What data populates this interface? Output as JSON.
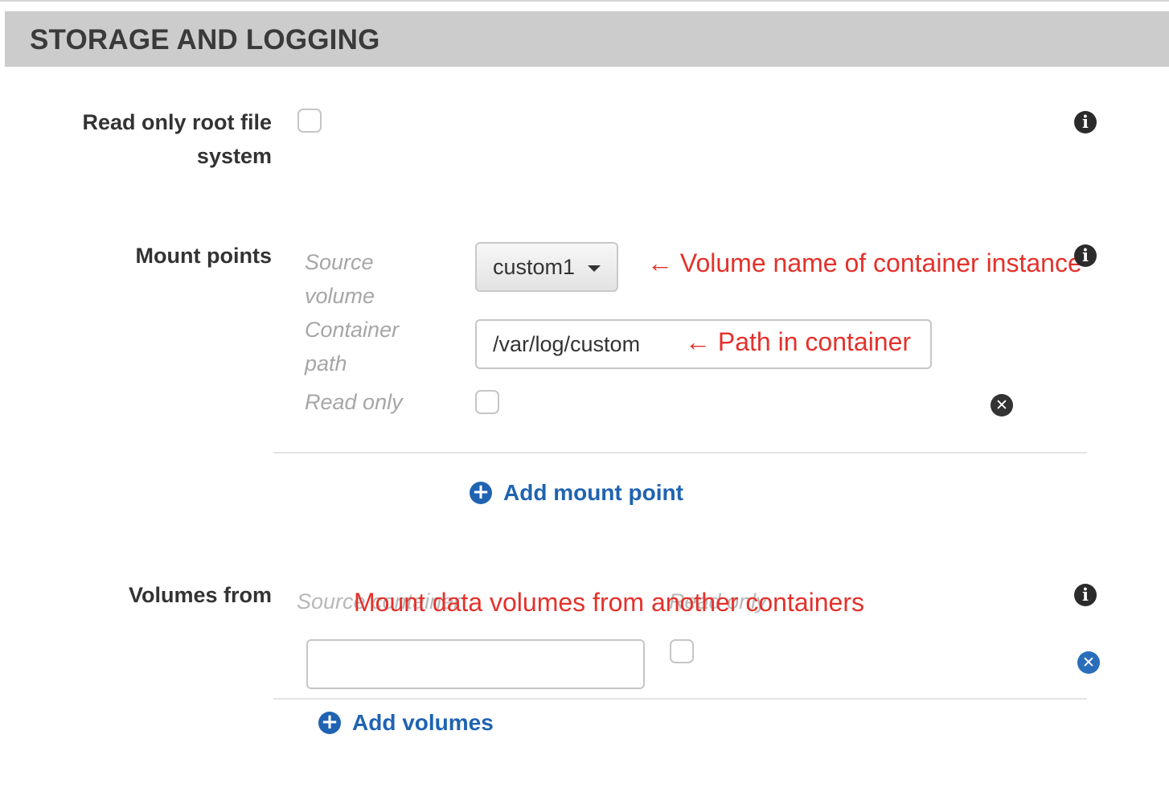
{
  "section": {
    "title": "STORAGE AND LOGGING"
  },
  "read_only_root": {
    "label_line1": "Read only root file",
    "label_line2": "system"
  },
  "mount_points": {
    "label": "Mount points",
    "source_volume_line1": "Source",
    "source_volume_line2": "volume",
    "container_path_line1": "Container",
    "container_path_line2": "path",
    "read_only_label": "Read only",
    "source_volume_value": "custom1",
    "container_path_value": "/var/log/custom",
    "add_label": "Add mount point"
  },
  "volumes_from": {
    "label": "Volumes from",
    "source_container_label": "Source container",
    "read_only_label": "Read only",
    "source_container_value": "",
    "add_label": "Add volumes"
  },
  "annotations": {
    "volume_name": "← Volume name of container instance",
    "path": "← Path in container",
    "volumes_from": "Mount data volumes from another containers"
  },
  "icons": {
    "info": "info-icon",
    "remove": "remove-icon",
    "add": "plus-circle-icon",
    "dropdown": "caret-down-icon"
  },
  "colors": {
    "header_bg": "#cccccc",
    "link_blue": "#1f63b2",
    "annotation_red": "#e4312b"
  }
}
